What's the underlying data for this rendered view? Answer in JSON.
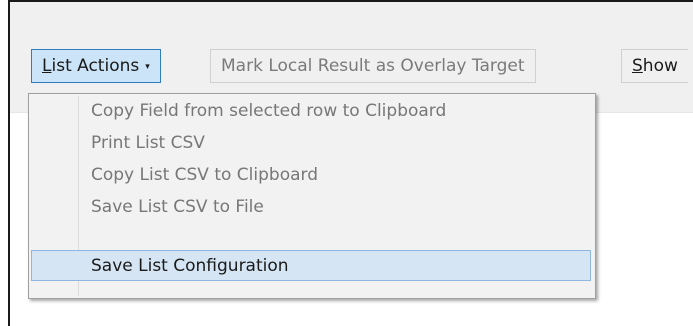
{
  "toolbar": {
    "list_actions": {
      "prefix": "",
      "underlined": "L",
      "rest": "ist Actions",
      "caret": "▾"
    },
    "mark_local": "Mark Local Result as Overlay Target",
    "show": {
      "underlined": "S",
      "rest": "how"
    }
  },
  "menu": {
    "items": [
      {
        "label": "Copy Field from selected row to Clipboard",
        "enabled": false
      },
      {
        "label": "Print List CSV",
        "enabled": false
      },
      {
        "label": "Copy List CSV to Clipboard",
        "enabled": false
      },
      {
        "label": "Save List CSV to File",
        "enabled": false
      },
      {
        "label": "Save List Configuration",
        "enabled": true,
        "highlighted": true
      }
    ]
  },
  "colors": {
    "toolbar_bg": "#f0f0f0",
    "active_button": "#cce4f7",
    "menu_highlight": "#d5e5f4",
    "disabled_text": "#777777"
  }
}
